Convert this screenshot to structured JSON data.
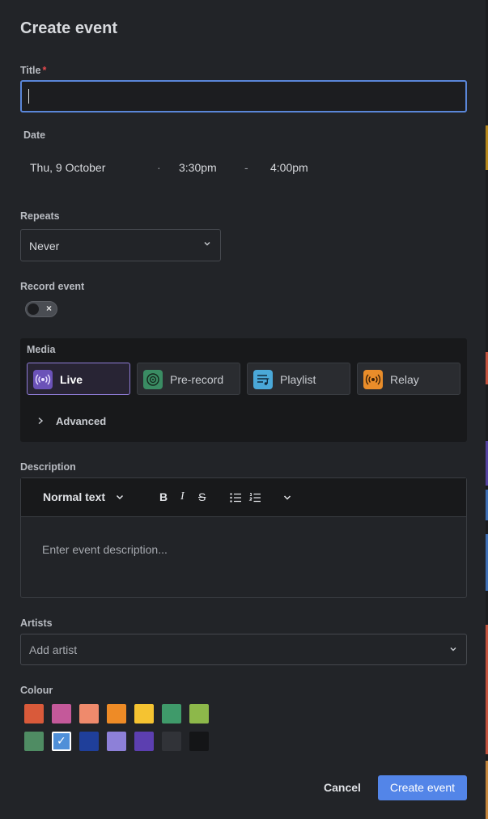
{
  "modal": {
    "title": "Create event"
  },
  "fields": {
    "title_label": "Title",
    "required_mark": "*",
    "title_value": "",
    "date_label": "Date",
    "date": "Thu, 9 October",
    "date_sep": "·",
    "start_time": "3:30pm",
    "time_sep": "-",
    "end_time": "4:00pm",
    "repeats_label": "Repeats",
    "repeats_value": "Never",
    "record_label": "Record event",
    "record_enabled": false
  },
  "media": {
    "label": "Media",
    "options": [
      {
        "label": "Live",
        "icon": "live-broadcast-icon",
        "color": "#7d5fcf",
        "selected": true
      },
      {
        "label": "Pre-record",
        "icon": "vinyl-record-icon",
        "color": "#3fa272",
        "selected": false
      },
      {
        "label": "Playlist",
        "icon": "playlist-icon",
        "color": "#4aa8d8",
        "selected": false
      },
      {
        "label": "Relay",
        "icon": "relay-broadcast-icon",
        "color": "#e98d2a",
        "selected": false
      }
    ],
    "advanced_label": "Advanced"
  },
  "description": {
    "label": "Description",
    "text_style": "Normal text",
    "placeholder": "Enter event description..."
  },
  "artists": {
    "label": "Artists",
    "placeholder": "Add artist"
  },
  "colour": {
    "label": "Colour",
    "swatches": [
      "#d95a3a",
      "#c4599a",
      "#ef8a6c",
      "#ee8b26",
      "#f5c331",
      "#3f9a6a",
      "#8db84a",
      "#4f8c63",
      "#4f8fd8",
      "#1f3f9a",
      "#8d80d8",
      "#5c3fb0",
      "#313338",
      "#141517"
    ],
    "selected_index": 8
  },
  "actions": {
    "cancel": "Cancel",
    "create": "Create event"
  }
}
